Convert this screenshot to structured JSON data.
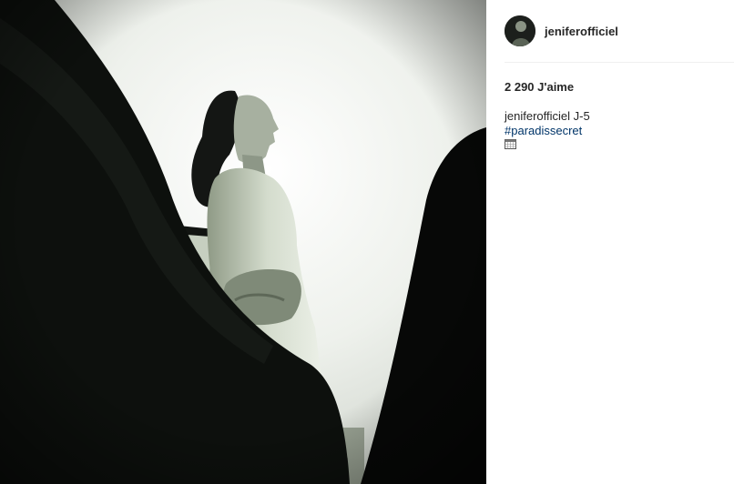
{
  "post": {
    "username": "jeniferofficiel",
    "likes_label": "2 290 J'aime",
    "caption": {
      "author": "jeniferofficiel",
      "text": "J-5",
      "hashtag": "#paradissecret",
      "emoji_icon": "calendar-icon"
    }
  }
}
